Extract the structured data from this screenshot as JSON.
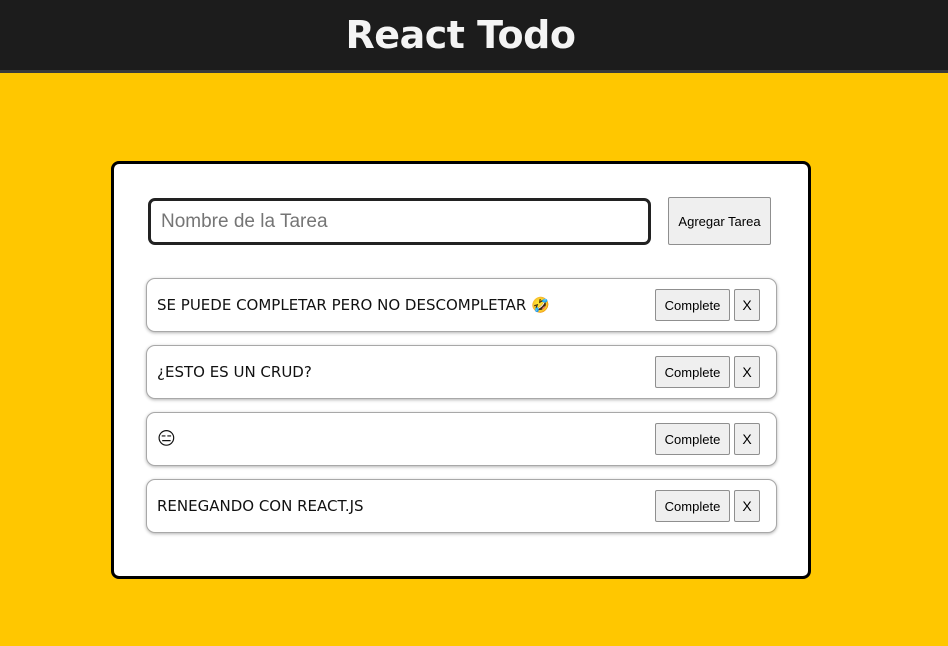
{
  "header": {
    "title": "React Todo"
  },
  "form": {
    "placeholder": "Nombre de la Tarea",
    "value": "",
    "add_label": "Agregar Tarea"
  },
  "todos": [
    {
      "text": "SE PUEDE COMPLETAR PERO NO DESCOMPLETAR 🤣",
      "complete_label": "Complete",
      "delete_label": "X"
    },
    {
      "text": "¿ESTO ES UN CRUD?",
      "complete_label": "Complete",
      "delete_label": "X"
    },
    {
      "text": "😑",
      "complete_label": "Complete",
      "delete_label": "X"
    },
    {
      "text": "RENEGANDO CON REACT.JS",
      "complete_label": "Complete",
      "delete_label": "X"
    }
  ],
  "colors": {
    "background": "#ffc700",
    "header": "#1c1c1c",
    "card": "#ffffff"
  }
}
